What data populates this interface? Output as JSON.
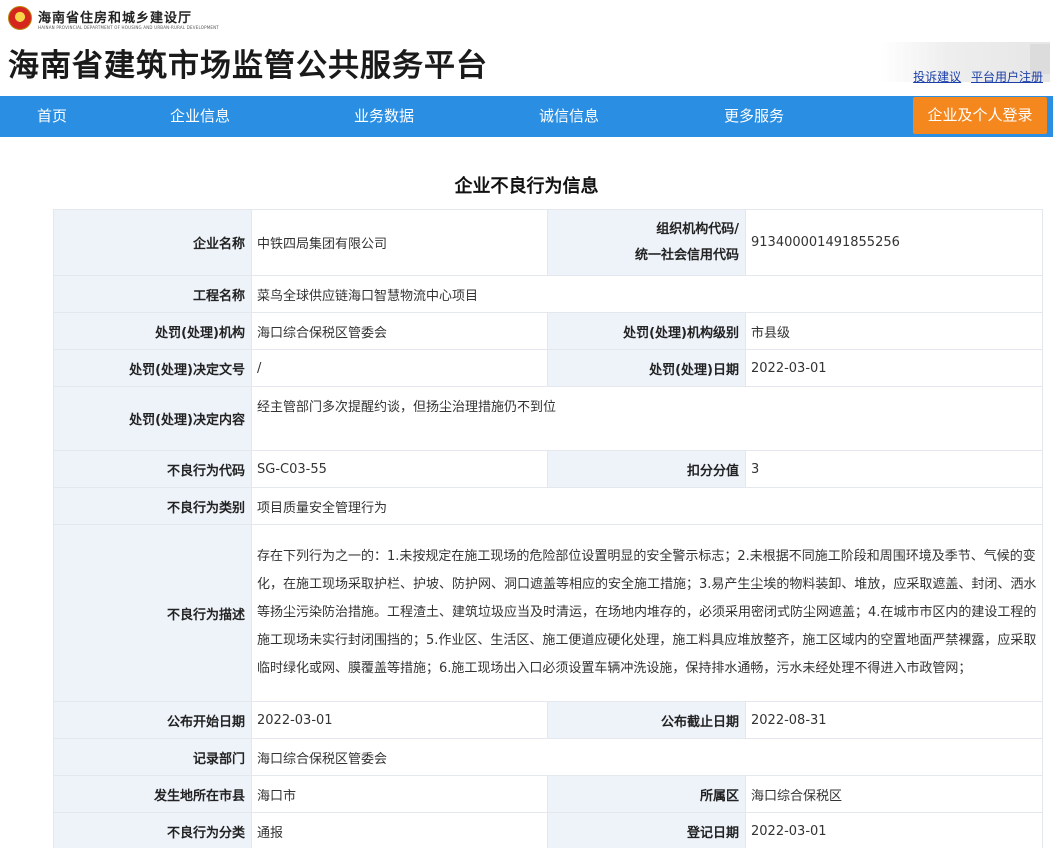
{
  "header": {
    "dept_name": "海南省住房和城乡建设厅",
    "dept_en": "HAINAN PROVINCIAL DEPARTMENT OF HOUSING AND URBAN-RURAL DEVELOPMENT",
    "site_title": "海南省建筑市场监管公共服务平台",
    "links": [
      "投诉建议",
      "平台用户注册"
    ]
  },
  "nav": {
    "items": [
      "首页",
      "企业信息",
      "业务数据",
      "诚信信息",
      "更多服务"
    ],
    "login": "企业及个人登录"
  },
  "page": {
    "heading": "企业不良行为信息"
  },
  "record": {
    "company_name_label": "企业名称",
    "company_name": "中铁四局集团有限公司",
    "org_code_label_1": "组织机构代码/",
    "org_code_label_2": "统一社会信用代码",
    "org_code": "913400001491855256",
    "project_name_label": "工程名称",
    "project_name": "菜鸟全球供应链海口智慧物流中心项目",
    "penalty_org_label": "处罚(处理)机构",
    "penalty_org": "海口综合保税区管委会",
    "penalty_org_level_label": "处罚(处理)机构级别",
    "penalty_org_level": "市县级",
    "decision_no_label": "处罚(处理)决定文号",
    "decision_no": "/",
    "penalty_date_label": "处罚(处理)日期",
    "penalty_date": "2022-03-01",
    "decision_content_label": "处罚(处理)决定内容",
    "decision_content": "经主管部门多次提醒约谈，但扬尘治理措施仍不到位",
    "behavior_code_label": "不良行为代码",
    "behavior_code": "SG-C03-55",
    "deduction_label": "扣分分值",
    "deduction": "3",
    "behavior_category_label": "不良行为类别",
    "behavior_category": "项目质量安全管理行为",
    "behavior_desc_label": "不良行为描述",
    "behavior_desc": "存在下列行为之一的：1.未按规定在施工现场的危险部位设置明显的安全警示标志；2.未根据不同施工阶段和周围环境及季节、气候的变化，在施工现场采取护栏、护坡、防护网、洞口遮盖等相应的安全施工措施；3.易产生尘埃的物料装卸、堆放，应采取遮盖、封闭、洒水等扬尘污染防治措施。工程渣土、建筑垃圾应当及时清运，在场地内堆存的，必须采用密闭式防尘网遮盖；4.在城市市区内的建设工程的施工现场未实行封闭围挡的；5.作业区、生活区、施工便道应硬化处理，施工料具应堆放整齐，施工区域内的空置地面严禁裸露，应采取临时绿化或网、膜覆盖等措施；6.施工现场出入口必须设置车辆冲洗设施，保持排水通畅，污水未经处理不得进入市政管网；",
    "publish_start_label": "公布开始日期",
    "publish_start": "2022-03-01",
    "publish_end_label": "公布截止日期",
    "publish_end": "2022-08-31",
    "record_dept_label": "记录部门",
    "record_dept": "海口综合保税区管委会",
    "city_label": "发生地所在市县",
    "city": "海口市",
    "district_label": "所属区",
    "district": "海口综合保税区",
    "classification_label": "不良行为分类",
    "classification": "通报",
    "register_date_label": "登记日期",
    "register_date": "2022-03-01"
  }
}
